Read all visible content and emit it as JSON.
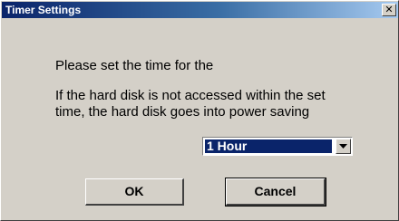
{
  "window": {
    "title": "Timer Settings",
    "close_glyph": "✕"
  },
  "body": {
    "prompt": "Please set the time for the",
    "description_line1": "If the hard disk is not accessed within the set",
    "description_line2": "time, the hard disk goes into power saving"
  },
  "timer_select": {
    "selected_value": "1 Hour",
    "arrow_icon": "chevron-down-icon"
  },
  "buttons": {
    "ok_label": "OK",
    "cancel_label": "Cancel"
  },
  "colors": {
    "dialog_bg": "#d4d0c8",
    "titlebar_start": "#0a246a",
    "titlebar_end": "#a6caf0",
    "selection": "#0a246a"
  }
}
